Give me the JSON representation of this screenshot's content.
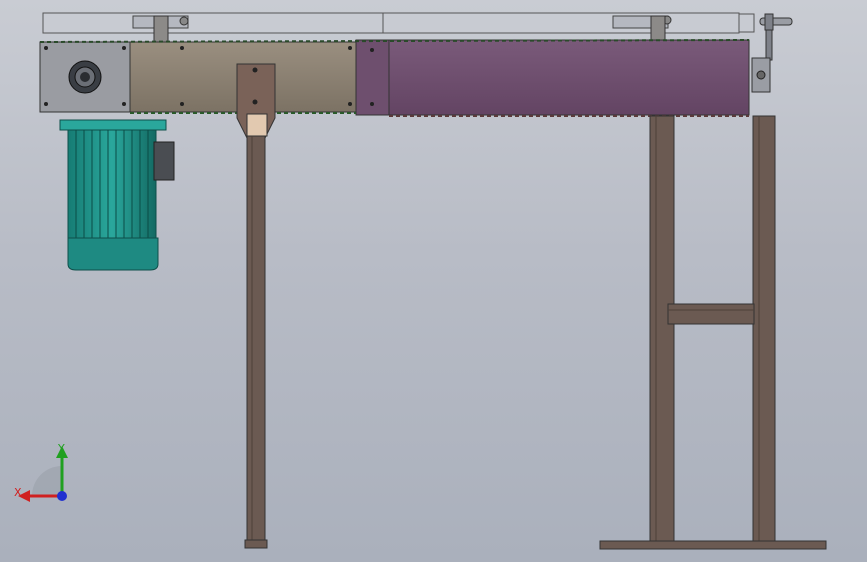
{
  "viewport": {
    "background_top": "#c9ccd3",
    "background_bottom": "#aab0bc"
  },
  "model": {
    "frame_color": "#6b5a52",
    "motor_color": "#1f8f86",
    "conveyor_left_color": "#8a8072",
    "conveyor_right_color": "#6e4f6e",
    "rail_color": "#c8cbd2"
  },
  "triad": {
    "x_label": "X",
    "y_label": "Y",
    "x_color": "#d02020",
    "y_color": "#20a020",
    "z_color": "#2030d0"
  }
}
